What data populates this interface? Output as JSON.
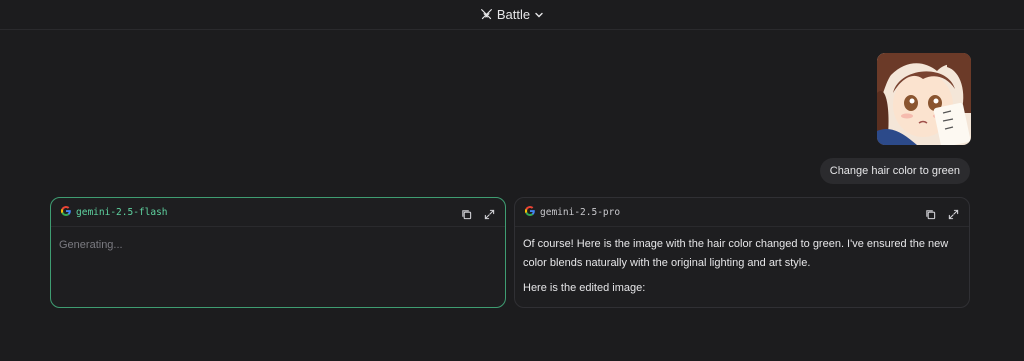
{
  "header": {
    "mode_label": "Battle"
  },
  "user_message": {
    "image_alt": "anime girl",
    "text": "Change hair color to green"
  },
  "panels": [
    {
      "model": "gemini-2.5-flash",
      "body": "Generating..."
    },
    {
      "model": "gemini-2.5-pro",
      "paragraphs": [
        "Of course! Here is the image with the hair color changed to green. I've ensured the new color blends naturally with the original lighting and art style.",
        "Here is the edited image:"
      ]
    }
  ],
  "colors": {
    "background": "#1c1c1e",
    "accent_green": "#3f9d72",
    "bubble": "#2b2b2e"
  }
}
